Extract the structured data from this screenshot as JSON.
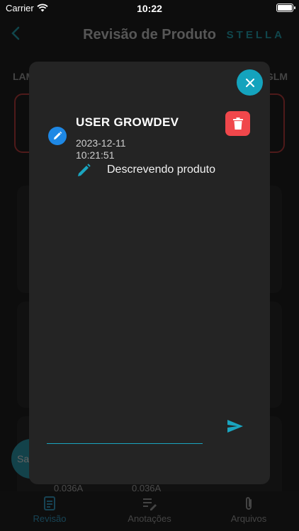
{
  "status_bar": {
    "carrier": "Carrier",
    "time": "10:22"
  },
  "background": {
    "title": "Revisão de Produto",
    "brand": "STELLA",
    "tab_left": "LAM",
    "tab_right": "GLM",
    "fab_label": "Sa",
    "amp_values": [
      "0.036A",
      "0.036A"
    ],
    "nav": [
      {
        "label": "Revisão",
        "icon": "document-icon"
      },
      {
        "label": "Anotações",
        "icon": "notes-edit-icon"
      },
      {
        "label": "Arquivos",
        "icon": "paperclip-icon"
      }
    ]
  },
  "modal": {
    "note": {
      "user": "USER GROWDEV",
      "date": "2023-12-11",
      "time": "10:21:51",
      "text": "Descrevendo produto"
    },
    "input": {
      "value": "",
      "placeholder": ""
    },
    "colors": {
      "accent": "#14a3bd",
      "delete": "#f0474b",
      "badge": "#1e88e5"
    }
  }
}
